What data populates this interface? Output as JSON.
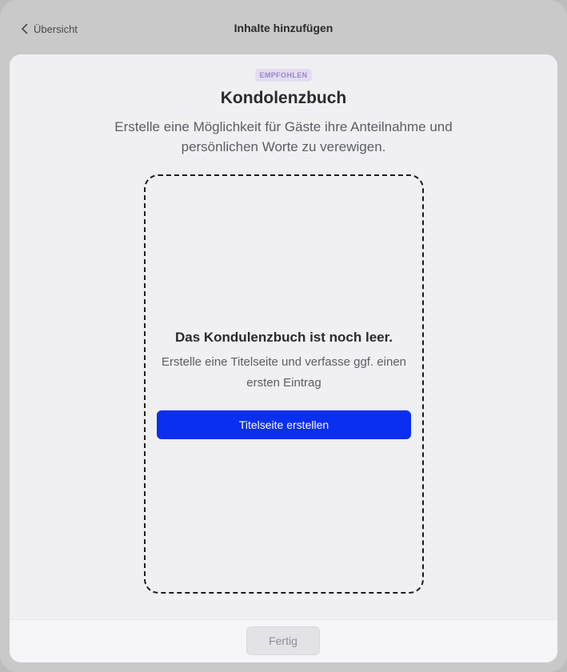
{
  "header": {
    "back_label": "Übersicht",
    "back_icon": "chevron-left-icon",
    "title": "Inhalte hinzufügen"
  },
  "content": {
    "badge": "EMPFOHLEN",
    "title": "Kondolenzbuch",
    "subtitle": "Erstelle eine Möglichkeit für Gäste ihre Anteilnahme und persönlichen Worte zu verewigen."
  },
  "empty_state": {
    "title": "Das Kondulenzbuch ist noch leer.",
    "description": "Erstelle eine Titelseite und verfasse ggf. einen ersten Eintrag",
    "button_label": "Titelseite erstellen"
  },
  "footer": {
    "done_label": "Fertig"
  },
  "colors": {
    "primary": "#0b2ff0",
    "badge_bg": "#e4dcf1",
    "badge_text": "#9b86c7"
  }
}
